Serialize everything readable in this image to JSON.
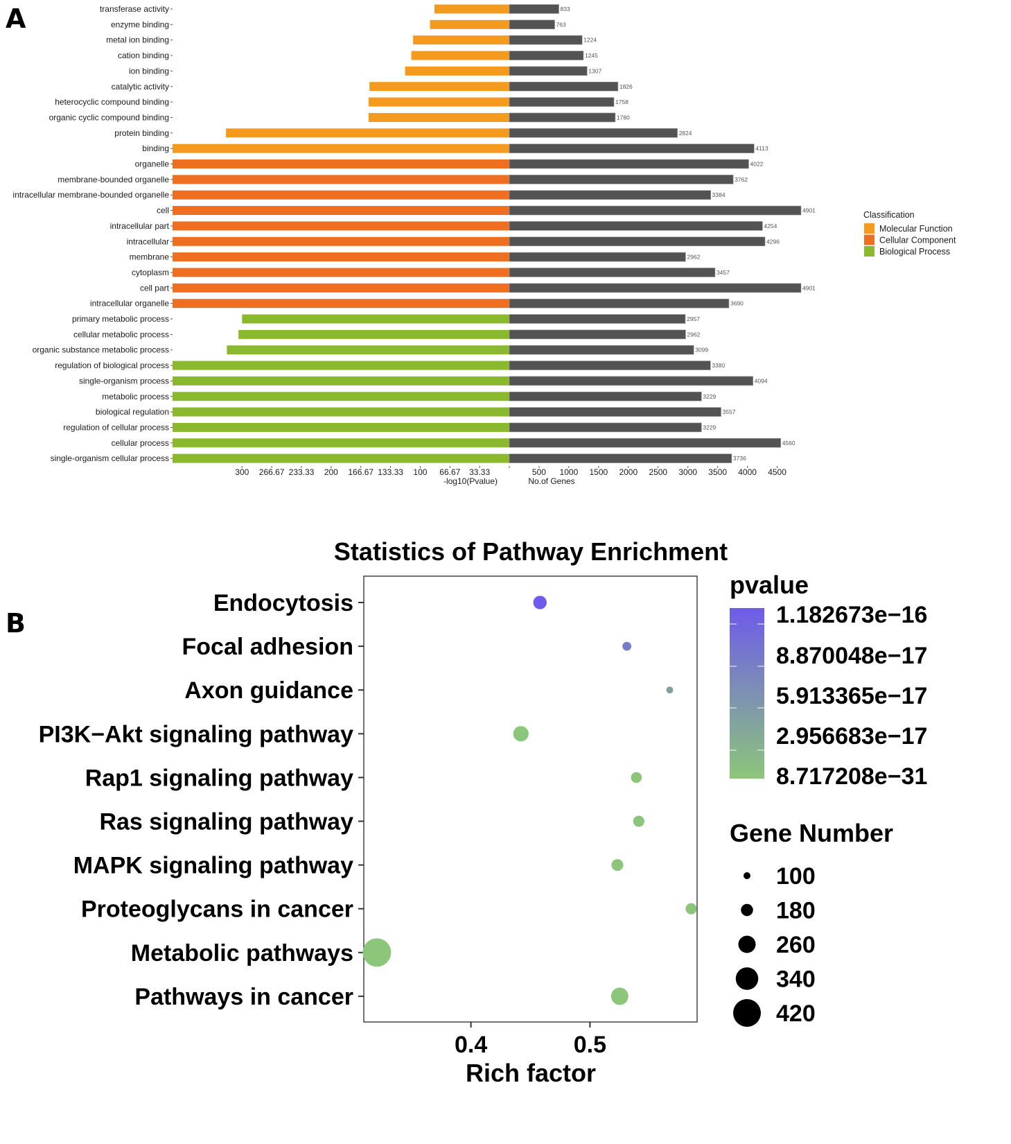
{
  "panels": {
    "a_label": "A",
    "b_label": "B"
  },
  "chart_data": [
    {
      "type": "bar",
      "panel": "A",
      "layout": "diverging-horizontal",
      "categories": [
        "transferase activity",
        "enzyme binding",
        "metal ion binding",
        "cation binding",
        "ion binding",
        "catalytic activity",
        "heterocyclic compound binding",
        "organic cyclic compound binding",
        "protein binding",
        "binding",
        "organelle",
        "membrane-bounded organelle",
        "intracellular membrane-bounded organelle",
        "cell",
        "intracellular part",
        "intracellular",
        "membrane",
        "cytoplasm",
        "cell part",
        "intracellular organelle",
        "primary metabolic process",
        "cellular metabolic process",
        "organic substance metabolic process",
        "regulation of biological process",
        "single-organism process",
        "metabolic process",
        "biological regulation",
        "regulation of cellular process",
        "cellular process",
        "single-organism cellular process"
      ],
      "classification": [
        "Molecular Function",
        "Molecular Function",
        "Molecular Function",
        "Molecular Function",
        "Molecular Function",
        "Molecular Function",
        "Molecular Function",
        "Molecular Function",
        "Molecular Function",
        "Molecular Function",
        "Cellular Component",
        "Cellular Component",
        "Cellular Component",
        "Cellular Component",
        "Cellular Component",
        "Cellular Component",
        "Cellular Component",
        "Cellular Component",
        "Cellular Component",
        "Cellular Component",
        "Biological Process",
        "Biological Process",
        "Biological Process",
        "Biological Process",
        "Biological Process",
        "Biological Process",
        "Biological Process",
        "Biological Process",
        "Biological Process",
        "Biological Process"
      ],
      "series": [
        {
          "name": "-log10(Pvalue)",
          "side": "left",
          "values": [
            84,
            89,
            108,
            110,
            117,
            157,
            158,
            158,
            318,
            378,
            378,
            378,
            378,
            378,
            378,
            378,
            378,
            378,
            378,
            378,
            300,
            304,
            317,
            378,
            378,
            378,
            378,
            378,
            378,
            378
          ]
        },
        {
          "name": "No.of Genes",
          "side": "right",
          "values": [
            833,
            763,
            1224,
            1245,
            1307,
            1826,
            1758,
            1780,
            2824,
            4113,
            4022,
            3762,
            3384,
            4901,
            4254,
            4296,
            2962,
            3457,
            4901,
            3690,
            2957,
            2962,
            3099,
            3380,
            4094,
            3229,
            3557,
            3229,
            4560,
            3736
          ],
          "labels": [
            "833",
            "763",
            "1224",
            "1245",
            "1307",
            "1826",
            "1758",
            "1780",
            "2824",
            "4113",
            "4022",
            "3762",
            "3384",
            "4901",
            "4254",
            "4296",
            "2962",
            "3457",
            "4901",
            "3690",
            "2957",
            "2962",
            "3099",
            "3380",
            "4094",
            "3229",
            "3557",
            "3229",
            "4560",
            "3736"
          ]
        }
      ],
      "left_axis": {
        "label": "-log10(Pvalue)",
        "ticks": [
          300,
          266.67,
          233.33,
          200,
          166.67,
          133.33,
          100,
          66.67,
          33.33
        ],
        "tick_labels": [
          "300",
          "266.67",
          "233.33",
          "200",
          "166.67",
          "133.33",
          "100",
          "66.67",
          "33.33"
        ],
        "range": [
          0,
          378
        ]
      },
      "right_axis": {
        "label": "No.of Genes",
        "ticks": [
          500,
          1000,
          1500,
          2000,
          2500,
          3000,
          3500,
          4000,
          4500
        ],
        "tick_labels": [
          "500",
          "1000",
          "1500",
          "2000",
          "2500",
          "3000",
          "3500",
          "4000",
          "4500"
        ],
        "range": [
          0,
          5000
        ]
      },
      "legend": {
        "title": "Classification",
        "placement": "right",
        "entries": [
          {
            "name": "Molecular Function",
            "color": "#F39A1F"
          },
          {
            "name": "Cellular Component",
            "color": "#EE6E22"
          },
          {
            "name": "Biological Process",
            "color": "#8AB92D"
          }
        ]
      },
      "gene_bar_color": "#545354",
      "grid": false
    },
    {
      "type": "scatter",
      "panel": "B",
      "title": "Statistics of Pathway Enrichment",
      "xlabel": "Rich factor",
      "ylabel": "",
      "categories": [
        "Endocytosis",
        "Focal adhesion",
        "Axon guidance",
        "PI3K−Akt signaling pathway",
        "Rap1 signaling pathway",
        "Ras signaling pathway",
        "MAPK signaling pathway",
        "Proteoglycans in cancer",
        "Metabolic pathways",
        "Pathways in cancer"
      ],
      "points": [
        {
          "pathway": "Endocytosis",
          "rich_factor": 0.458,
          "gene_number": 200,
          "pvalue": 1.18e-16
        },
        {
          "pathway": "Focal adhesion",
          "rich_factor": 0.531,
          "gene_number": 130,
          "pvalue": 8.3e-17
        },
        {
          "pathway": "Axon guidance",
          "rich_factor": 0.567,
          "gene_number": 100,
          "pvalue": 4e-17
        },
        {
          "pathway": "PI3K−Akt signaling pathway",
          "rich_factor": 0.442,
          "gene_number": 230,
          "pvalue": 1e-20
        },
        {
          "pathway": "Rap1 signaling pathway",
          "rich_factor": 0.539,
          "gene_number": 160,
          "pvalue": 1e-20
        },
        {
          "pathway": "Ras signaling pathway",
          "rich_factor": 0.541,
          "gene_number": 165,
          "pvalue": 1e-20
        },
        {
          "pathway": "MAPK signaling pathway",
          "rich_factor": 0.523,
          "gene_number": 175,
          "pvalue": 1e-20
        },
        {
          "pathway": "Proteoglycans in cancer",
          "rich_factor": 0.585,
          "gene_number": 165,
          "pvalue": 1e-20
        },
        {
          "pathway": "Metabolic pathways",
          "rich_factor": 0.321,
          "gene_number": 430,
          "pvalue": 8.717208e-31
        },
        {
          "pathway": "Pathways in cancer",
          "rich_factor": 0.525,
          "gene_number": 260,
          "pvalue": 1e-20
        }
      ],
      "xlim": [
        0.31,
        0.59
      ],
      "xticks": [
        0.4,
        0.5
      ],
      "xtick_labels": [
        "0.4",
        "0.5"
      ],
      "color_legend": {
        "title": "pvalue",
        "low_color": "#8CC67A",
        "high_color": "#6E5BEB",
        "range": [
          8.717208e-31,
          1.182673e-16
        ],
        "ticks": [
          1.182673e-16,
          8.870048e-17,
          5.913365e-17,
          2.956683e-17,
          8.717208e-31
        ],
        "tick_labels": [
          "1.182673e−16",
          "8.870048e−17",
          "5.913365e−17",
          "2.956683e−17",
          "8.717208e−31"
        ]
      },
      "size_legend": {
        "title": "Gene Number",
        "values": [
          100,
          180,
          260,
          340,
          420
        ],
        "labels": [
          "100",
          "180",
          "260",
          "340",
          "420"
        ]
      },
      "grid": false
    }
  ]
}
